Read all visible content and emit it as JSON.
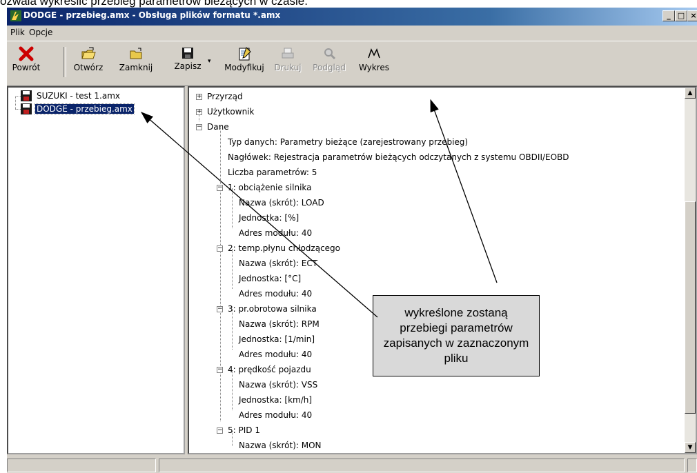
{
  "caption": {
    "text": "ozwala wykreślić przebieg parametrów bieżących w czasie."
  },
  "window": {
    "title": "DODGE - przebieg.amx - Obsługa plików formatu *.amx",
    "buttons": {
      "minimize": "_",
      "maximize": "□",
      "close": "×"
    }
  },
  "menu": {
    "items": [
      "Plik",
      "Opcje"
    ]
  },
  "toolbar": {
    "back": "Powrót",
    "open": "Otwórz",
    "close": "Zamknij",
    "save": "Zapisz",
    "modify": "Modyfikuj",
    "print": "Drukuj",
    "preview": "Podgląd",
    "chart": "Wykres"
  },
  "files": [
    {
      "label": "SUZUKI - test 1.amx",
      "selected": false
    },
    {
      "label": "DODGE - przebieg.amx",
      "selected": true
    }
  ],
  "tree": {
    "przyrzad": "Przyrząd",
    "uzytkownik": "Użytkownik",
    "dane": "Dane",
    "typ": "Typ danych: Parametry bieżące (zarejestrowany przebieg)",
    "naglowek": "Nagłówek: Rejestracja parametrów bieżących odczytanych z systemu OBDII/EOBD",
    "liczba": "Liczba parametrów: 5",
    "p1": {
      "title": "1: obciążenie silnika",
      "name": "Nazwa (skrót): LOAD",
      "unit": "Jednostka: [%]",
      "addr": "Adres modułu: 40"
    },
    "p2": {
      "title": "2: temp.płynu chłodzącego",
      "name": "Nazwa (skrót): ECT",
      "unit": "Jednostka: [°C]",
      "addr": "Adres modułu: 40"
    },
    "p3": {
      "title": "3: pr.obrotowa silnika",
      "name": "Nazwa (skrót): RPM",
      "unit": "Jednostka: [1/min]",
      "addr": "Adres modułu: 40"
    },
    "p4": {
      "title": "4: prędkość pojazdu",
      "name": "Nazwa (skrót): VSS",
      "unit": "Jednostka: [km/h]",
      "addr": "Adres modułu: 40"
    },
    "p5": {
      "title": "5: PID 1",
      "name": "Nazwa (skrót): MON"
    }
  },
  "callout": {
    "text": "wykreślone zostaną przebiegi parametrów zapisanych w zaznaczonym pliku"
  },
  "colors": {
    "titlebar": "#0a246a",
    "selection": "#0a246a",
    "callout_bg": "#d9d9d9",
    "close_x": "#cc0000"
  }
}
